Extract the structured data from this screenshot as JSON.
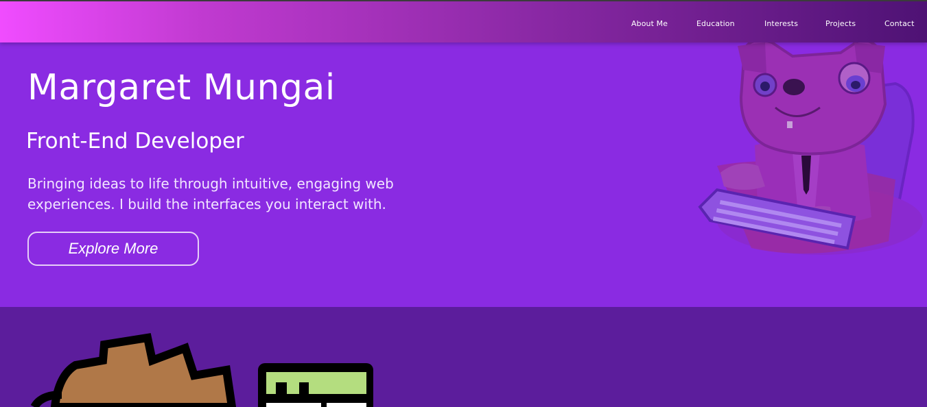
{
  "nav": {
    "items": [
      {
        "label": "About Me"
      },
      {
        "label": "Education"
      },
      {
        "label": "Interests"
      },
      {
        "label": "Projects"
      },
      {
        "label": "Contact"
      }
    ]
  },
  "hero": {
    "name": "Margaret Mungai",
    "role": "Front-End Developer",
    "tagline": "Bringing ideas to life through intuitive, engaging web experiences. I build the interfaces you interact with.",
    "cta_label": "Explore More",
    "illustration": "pixel-pug-at-keyboard-icon"
  },
  "lower": {
    "illustrations": [
      "cartoon-character-hair-icon",
      "browser-window-icon"
    ]
  },
  "colors": {
    "nav_gradient_start": "#f04cff",
    "nav_gradient_end": "#4e1274",
    "hero_bg": "#8a2be2",
    "lower_bg": "#5c1d9c",
    "text": "#ffffff"
  }
}
